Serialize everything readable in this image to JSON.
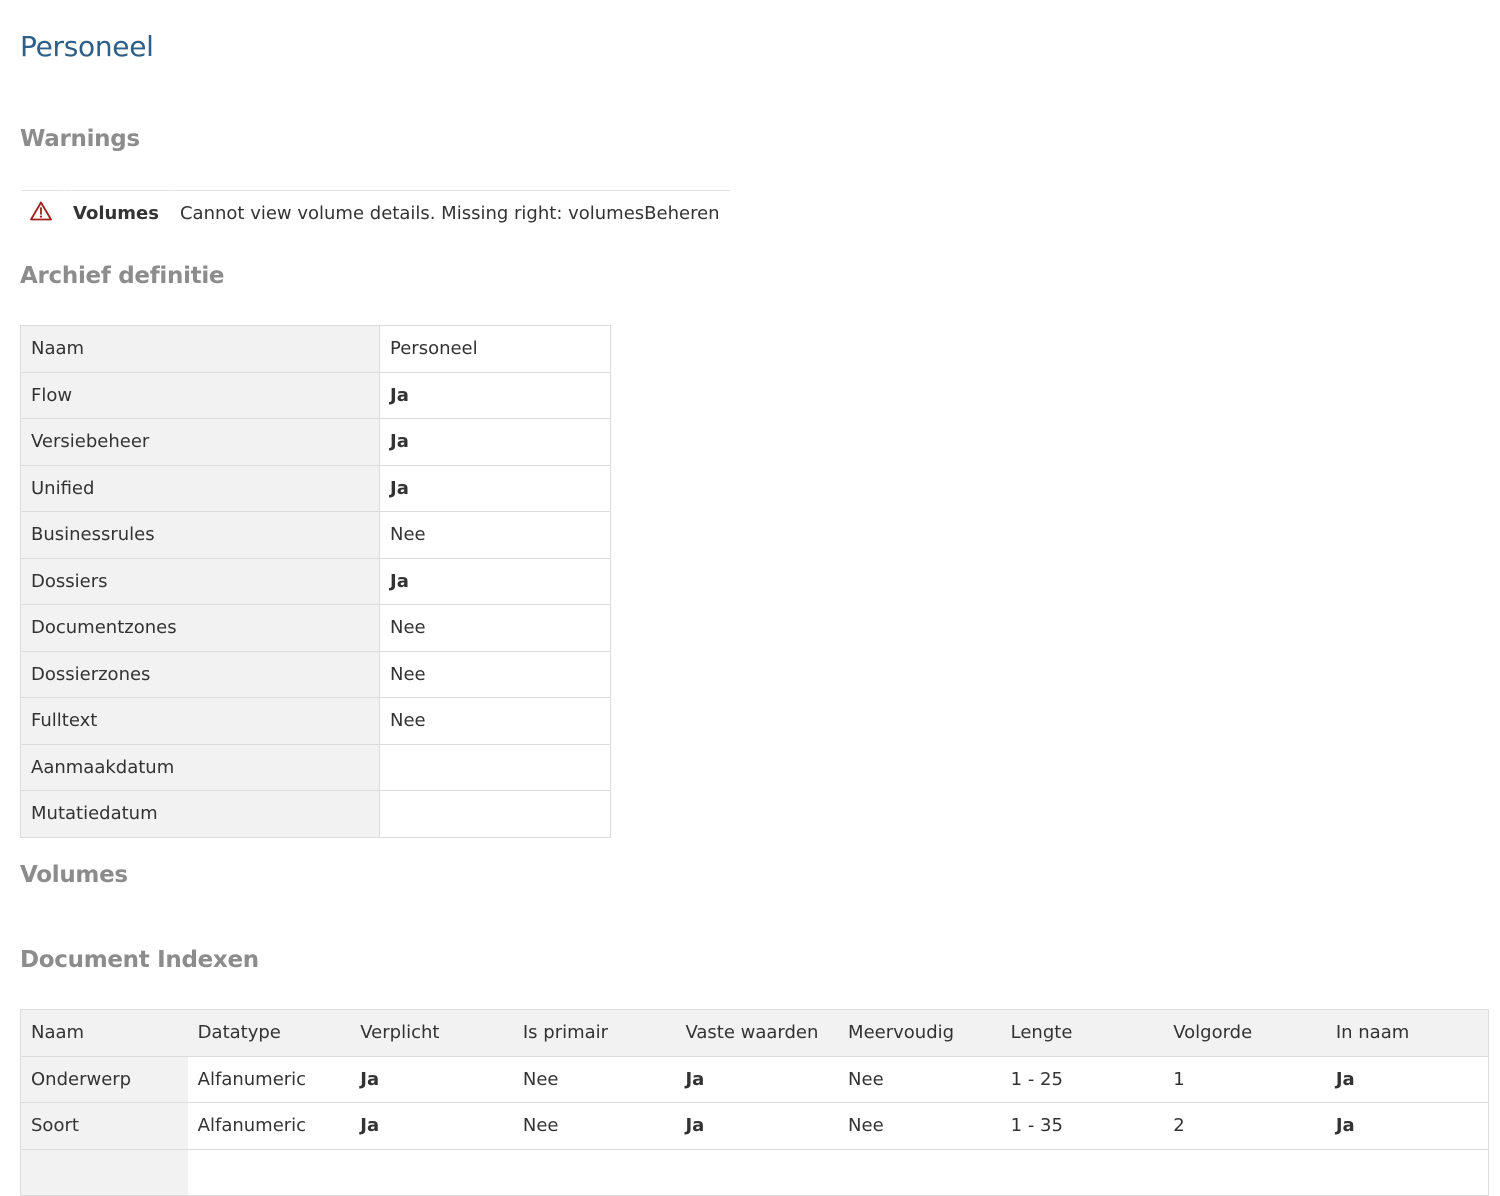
{
  "page": {
    "title": "Personeel"
  },
  "sections": {
    "warnings": "Warnings",
    "archive_definition": "Archief definitie",
    "volumes": "Volumes",
    "document_indexes": "Document Indexen"
  },
  "warnings": [
    {
      "icon": "warning-triangle-icon",
      "category": "Volumes",
      "message": "Cannot view volume details. Missing right: volumesBeheren"
    }
  ],
  "archive_definition": [
    {
      "key": "Naam",
      "value": "Personeel",
      "bold": false
    },
    {
      "key": "Flow",
      "value": "Ja",
      "bold": true
    },
    {
      "key": "Versiebeheer",
      "value": "Ja",
      "bold": true
    },
    {
      "key": "Unified",
      "value": "Ja",
      "bold": true
    },
    {
      "key": "Businessrules",
      "value": "Nee",
      "bold": false
    },
    {
      "key": "Dossiers",
      "value": "Ja",
      "bold": true
    },
    {
      "key": "Documentzones",
      "value": "Nee",
      "bold": false
    },
    {
      "key": "Dossierzones",
      "value": "Nee",
      "bold": false
    },
    {
      "key": "Fulltext",
      "value": "Nee",
      "bold": false
    },
    {
      "key": "Aanmaakdatum",
      "value": "",
      "bold": false
    },
    {
      "key": "Mutatiedatum",
      "value": "",
      "bold": false
    }
  ],
  "document_indexes": {
    "columns": [
      "Naam",
      "Datatype",
      "Verplicht",
      "Is primair",
      "Vaste waarden",
      "Meervoudig",
      "Lengte",
      "Volgorde",
      "In naam"
    ],
    "rows": [
      [
        "Onderwerp",
        "Alfanumeric",
        "Ja",
        "Nee",
        "Ja",
        "Nee",
        "1 - 25",
        "1",
        "Ja"
      ],
      [
        "Soort",
        "Alfanumeric",
        "Ja",
        "Nee",
        "Ja",
        "Nee",
        "1 - 35",
        "2",
        "Ja"
      ],
      [
        "",
        "",
        "",
        "",
        "",
        "",
        "",
        "",
        ""
      ]
    ]
  },
  "colors": {
    "title": "#2e5f88",
    "section_title": "#8c8c8c",
    "warning_icon": "#a31d1d",
    "key_background": "#f2f2f2",
    "border": "#dcdcdc"
  }
}
